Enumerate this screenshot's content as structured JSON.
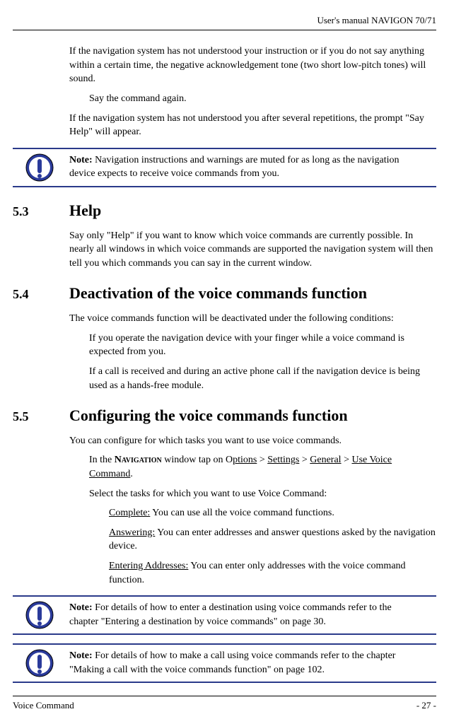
{
  "header": {
    "title": "User's manual NAVIGON 70/71"
  },
  "intro": {
    "p1": "If the navigation system has not understood your instruction or if you do not say anything within a certain time, the negative acknowledgement tone (two short low-pitch tones) will sound.",
    "p2": "Say the command again.",
    "p3": "If the navigation system has not understood you after several repetitions, the prompt \"Say Help\" will appear."
  },
  "note1": {
    "label": "Note:",
    "text": " Navigation instructions and warnings are muted for as long as the navigation device expects to receive voice commands from you."
  },
  "section53": {
    "num": "5.3",
    "title": "Help",
    "p1": "Say only \"Help\" if you want to know which voice commands are currently possible. In nearly all windows in which voice commands are supported the navigation system will then tell you which commands you can say in the current window."
  },
  "section54": {
    "num": "5.4",
    "title": "Deactivation of the voice commands function",
    "p1": "The voice commands function will be deactivated under the following conditions:",
    "p2": "If you operate the navigation device with your finger while a voice command is expected from you.",
    "p3": "If a call is received and during an active phone call if the navigation device is being used as a hands-free module."
  },
  "section55": {
    "num": "5.5",
    "title": "Configuring the voice commands function",
    "p1": "You can configure for which tasks you want to use voice commands.",
    "p2a": "In the ",
    "p2_nav": "Navigation",
    "p2b": " window tap on O",
    "p2_opt": "ptions",
    "p2_gt1": " > ",
    "p2_set": "Settings",
    "p2_gt2": " > ",
    "p2_gen": "General",
    "p2_gt3": " > ",
    "p2_uvc": "Use Voice Command",
    "p2_dot": ".",
    "p3": "Select the tasks for which you want to use Voice Command:",
    "opt1_label": "Complete:",
    "opt1_text": " You can use all the voice command functions.",
    "opt2_label": "Answering:",
    "opt2_text": " You can enter addresses and answer questions asked by the navigation device.",
    "opt3_label": "Entering Addresses:",
    "opt3_text": " You can enter only addresses with the voice command function."
  },
  "note2": {
    "label": "Note:",
    "text": " For details of how to enter a destination using voice commands refer to the chapter \"Entering a destination by voice commands\" on page 30."
  },
  "note3": {
    "label": "Note:",
    "text": " For details of how to make a call using voice commands refer to the chapter \"Making a call with the voice commands function\" on page 102."
  },
  "footer": {
    "left": "Voice Command",
    "right": "- 27 -"
  }
}
